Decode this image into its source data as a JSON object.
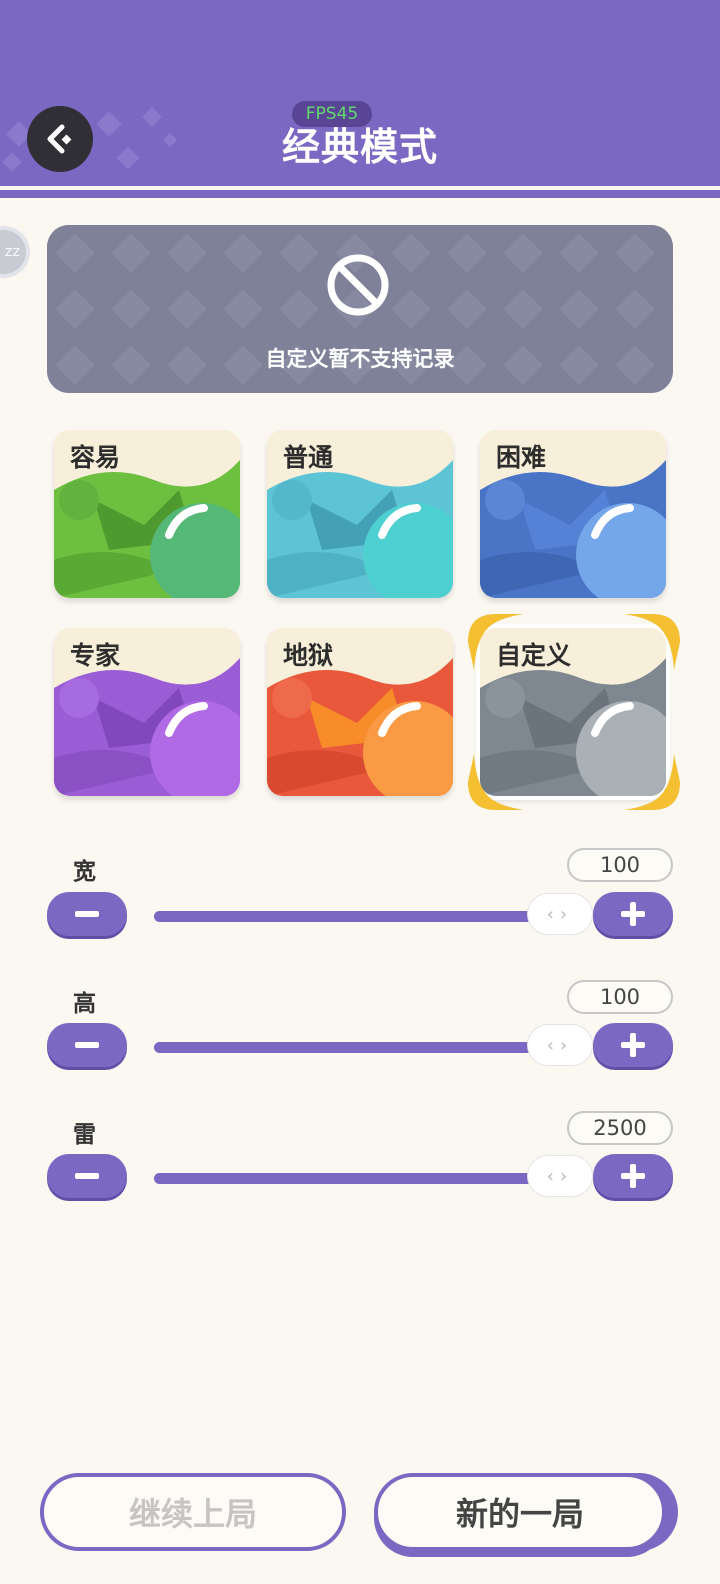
{
  "header": {
    "title": "经典模式",
    "fps": "FPS45",
    "back_icon": "back-arrow-icon"
  },
  "side_badge": {
    "text": "ZZ"
  },
  "notice": {
    "icon": "ban-icon",
    "text": "自定义暂不支持记录"
  },
  "difficulties": [
    {
      "label": "容易",
      "color": "#6dbf3f"
    },
    {
      "label": "普通",
      "color": "#5cc4d4"
    },
    {
      "label": "困难",
      "color": "#4a74c5"
    },
    {
      "label": "专家",
      "color": "#9b5dd6"
    },
    {
      "label": "地狱",
      "color": "#e9583b"
    },
    {
      "label": "自定义",
      "color": "#7f8891",
      "selected": true
    }
  ],
  "sliders": [
    {
      "label": "宽",
      "value": "100"
    },
    {
      "label": "高",
      "value": "100"
    },
    {
      "label": "雷",
      "value": "2500"
    }
  ],
  "buttons": {
    "continue": "继续上局",
    "new_game": "新的一局"
  },
  "colors": {
    "accent": "#7b68c2",
    "background": "#fbf8f2",
    "selection": "#f5bf32"
  }
}
